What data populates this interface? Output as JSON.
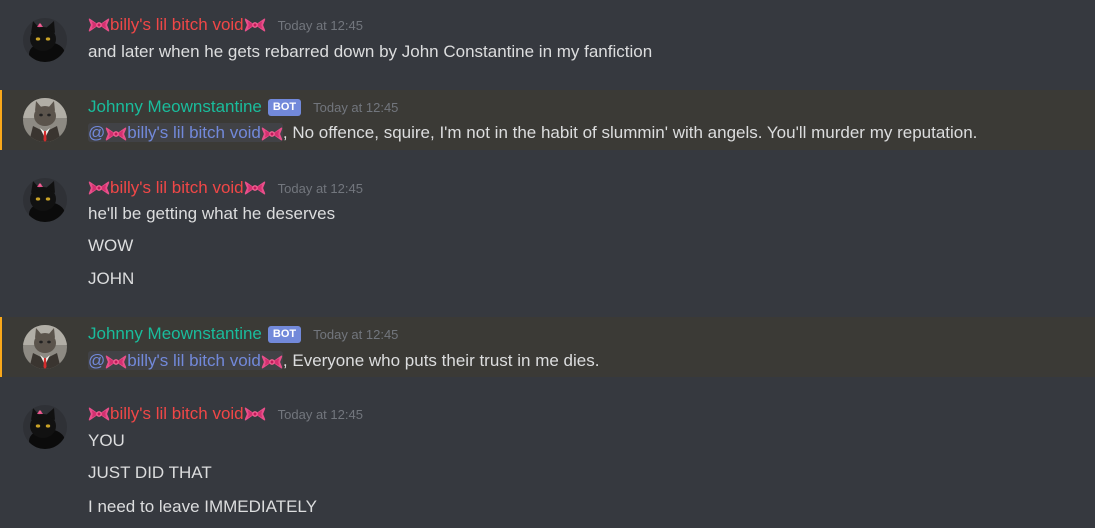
{
  "messages": [
    {
      "author": "billy's lil bitch void",
      "timestamp": "Today at 12:45",
      "lines": [
        "and later when he gets rebarred down by John Constantine in my fanfiction"
      ]
    },
    {
      "author": "Johnny Meownstantine",
      "bot_tag": "BOT",
      "timestamp": "Today at 12:45",
      "mention_prefix": "@",
      "mention_name": "billy's lil bitch void",
      "text": ", No offence, squire, I'm not in the habit of slummin' with angels. You'll murder my reputation."
    },
    {
      "author": "billy's lil bitch void",
      "timestamp": "Today at 12:45",
      "lines": [
        "he'll be getting what he deserves",
        "WOW",
        "JOHN"
      ]
    },
    {
      "author": "Johnny Meownstantine",
      "bot_tag": "BOT",
      "timestamp": "Today at 12:45",
      "mention_prefix": "@",
      "mention_name": "billy's lil bitch void",
      "text": ", Everyone who puts their trust in me dies."
    },
    {
      "author": "billy's lil bitch void",
      "timestamp": "Today at 12:45",
      "lines": [
        "YOU",
        "JUST DID THAT",
        "I need to leave IMMEDIATELY"
      ]
    }
  ],
  "colors": {
    "background": "#36393f",
    "highlight_background": "#3b3a36",
    "highlight_bar": "#faa81a",
    "user_red": "#f04747",
    "bot_teal": "#1abc9c",
    "mention": "#7289da",
    "timestamp": "#72767d",
    "text": "#dcddde"
  },
  "icons": {
    "bow": "ribbon-bow-emoji",
    "cat_avatar": "black-cat-avatar",
    "bot_avatar": "cat-in-trenchcoat-avatar"
  }
}
